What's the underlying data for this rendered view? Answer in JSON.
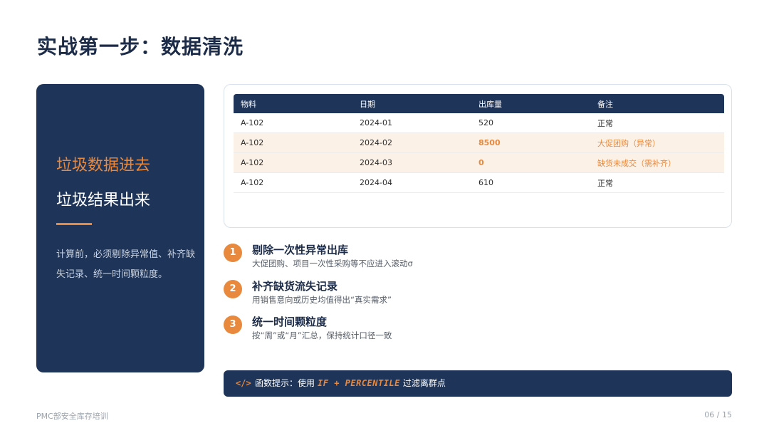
{
  "title": "实战第一步：数据清洗",
  "left_panel": {
    "line1": "垃圾数据进去",
    "line2": "垃圾结果出来",
    "description": "计算前，必须剔除异常值、补齐缺失记录、统一时间颗粒度。"
  },
  "table": {
    "headers": [
      "物料",
      "日期",
      "出库量",
      "备注"
    ],
    "rows": [
      {
        "material": "A-102",
        "date": "2024-01",
        "qty": "520",
        "note": "正常"
      },
      {
        "material": "A-102",
        "date": "2024-02",
        "qty": "8500",
        "note": "大促团购（异常）"
      },
      {
        "material": "A-102",
        "date": "2024-03",
        "qty": "0",
        "note": "缺货未成交（需补齐）"
      },
      {
        "material": "A-102",
        "date": "2024-04",
        "qty": "610",
        "note": "正常"
      }
    ]
  },
  "steps": [
    {
      "num": "1",
      "title": "剔除一次性异常出库",
      "subtitle": "大促团购、项目一次性采购等不应进入滚动σ"
    },
    {
      "num": "2",
      "title": "补齐缺货流失记录",
      "subtitle": "用销售意向或历史均值得出“真实需求”"
    },
    {
      "num": "3",
      "title": "统一时间颗粒度",
      "subtitle": "按“周”或“月”汇总，保持统计口径一致"
    }
  ],
  "tip": {
    "icon": "</>",
    "prefix": "函数提示：使用",
    "formula": "IF + PERCENTILE",
    "suffix": "过滤离群点"
  },
  "footer": {
    "left": "PMC部安全库存培训",
    "right": "06 / 15"
  },
  "colors": {
    "navy": "#1e3459",
    "accent": "#e8893d",
    "highlight_row": "#fbf1e6"
  }
}
